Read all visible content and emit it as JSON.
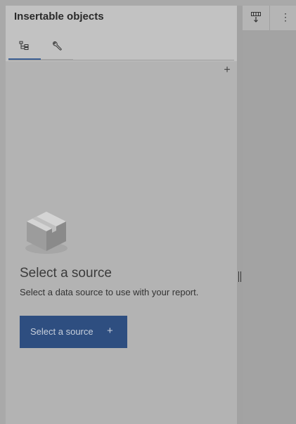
{
  "panel": {
    "title": "Insertable objects",
    "tabs": [
      {
        "name": "data-source-tab",
        "icon": "data-tree-icon",
        "active": true
      },
      {
        "name": "toolbox-tab",
        "icon": "wrench-icon",
        "active": false
      }
    ],
    "add_label": "+"
  },
  "empty_state": {
    "icon": "box-icon",
    "title": "Select a source",
    "description": "Select a data source to use with your report.",
    "button_label": "Select a source",
    "button_icon": "+"
  },
  "toolbar": {
    "buttons": [
      {
        "name": "insert-table-icon"
      },
      {
        "name": "overflow-menu-icon",
        "glyph": "⋮"
      }
    ]
  },
  "colors": {
    "accent": "#2e4e80",
    "tab_indicator": "#3c5f94"
  }
}
